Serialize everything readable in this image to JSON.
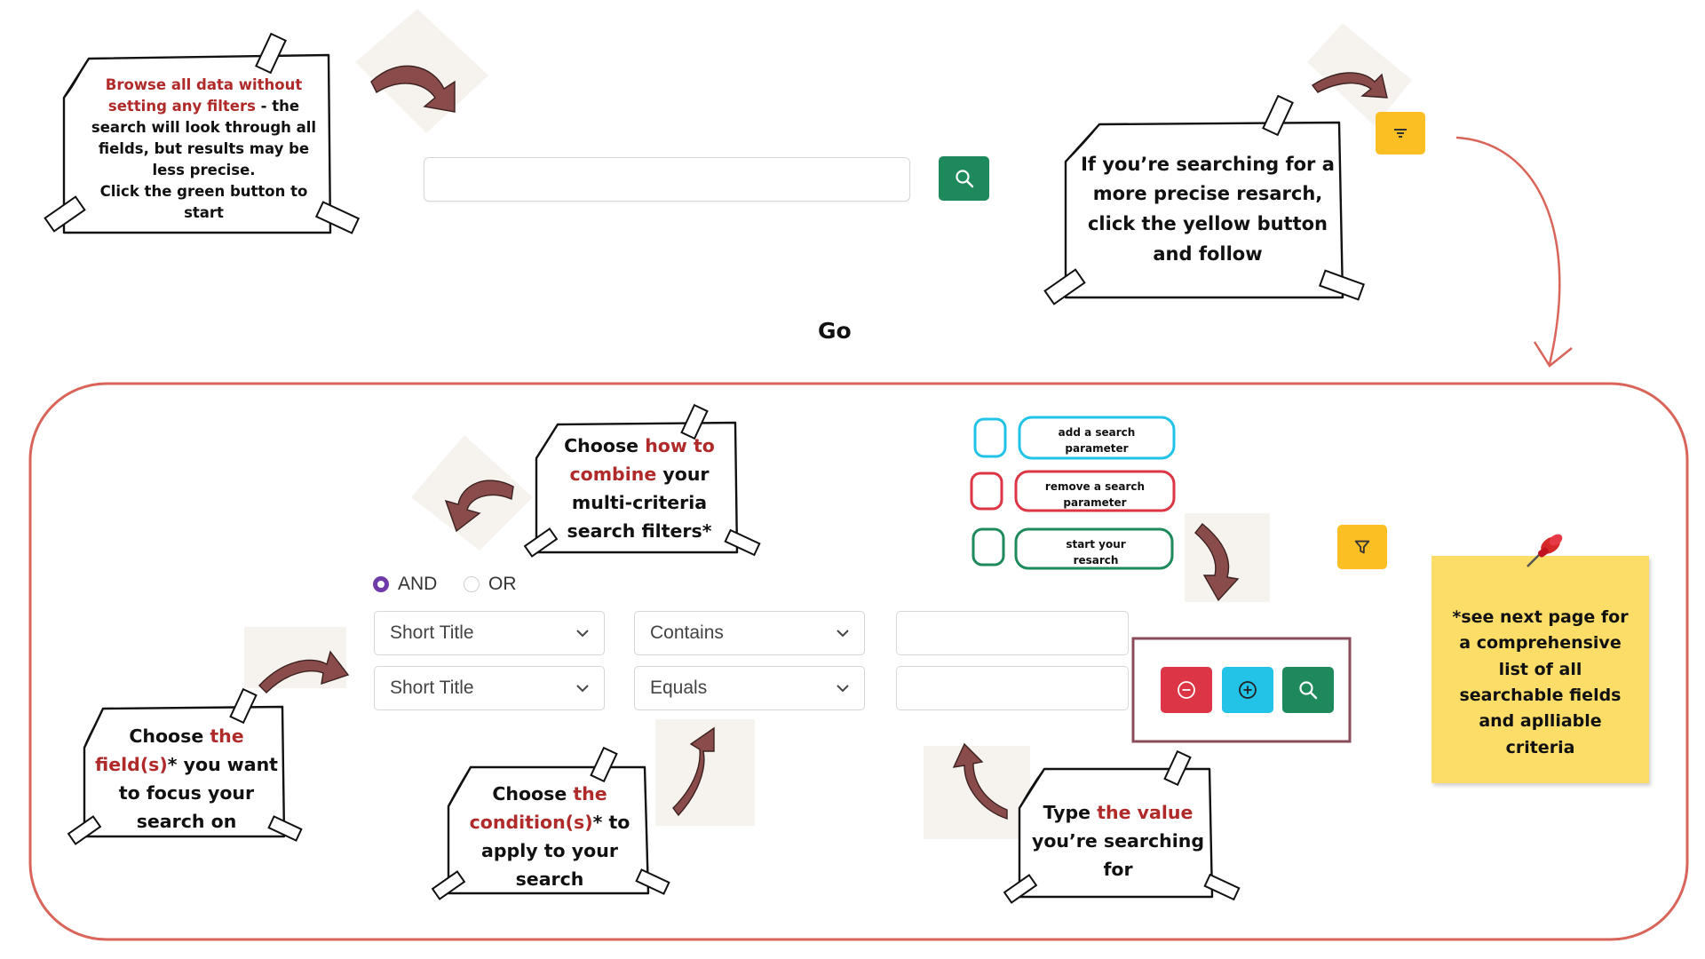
{
  "notes": {
    "browse": {
      "red": "Browse all data without setting any filters",
      "rest": " - the search will look through all fields, but results may be less precise.",
      "line2": "Click the green button to start"
    },
    "precise": "If you’re searching for a more precise resarch, click the yellow button and follow",
    "combine": {
      "a": "Choose ",
      "b": "how to combine",
      "c": " your multi-criteria search filters*"
    },
    "field": {
      "a": "Choose ",
      "b": "the field(s)",
      "c": "* you want to focus your search on"
    },
    "condition": {
      "a": "Choose ",
      "b": "the condition(s)",
      "c": "* to apply to your search"
    },
    "value": {
      "a": "Type ",
      "b": "the value",
      "c": " you’re searching for"
    }
  },
  "go_label": "Go",
  "logic": {
    "and": "AND",
    "or": "OR",
    "selected": "AND"
  },
  "rows": [
    {
      "field": "Short Title",
      "condition": "Contains",
      "value": ""
    },
    {
      "field": "Short Title",
      "condition": "Equals",
      "value": ""
    }
  ],
  "legend": {
    "add": "add a search parameter",
    "remove": "remove a search parameter",
    "start": "start your resarch"
  },
  "sticky": "*see next page for a comprehensive list of all searchable fields and aplliable criteria",
  "icons": {
    "search": "search-icon",
    "filter": "filter-icon",
    "filter_lines": "filter-lines-icon",
    "minus": "minus-circle-icon",
    "plus": "plus-circle-icon",
    "chevron": "chevron-down-icon",
    "pin": "pushpin-icon"
  },
  "colors": {
    "green": "#1e8a5c",
    "yellow": "#fbbf24",
    "red_button": "#dc3545",
    "cyan": "#22c3e6",
    "frame": "#d9655a",
    "accent_red": "#b02a2a",
    "radio": "#6f3ba8",
    "arrow": "#8a4c4a",
    "sticky": "#fbdd68"
  }
}
